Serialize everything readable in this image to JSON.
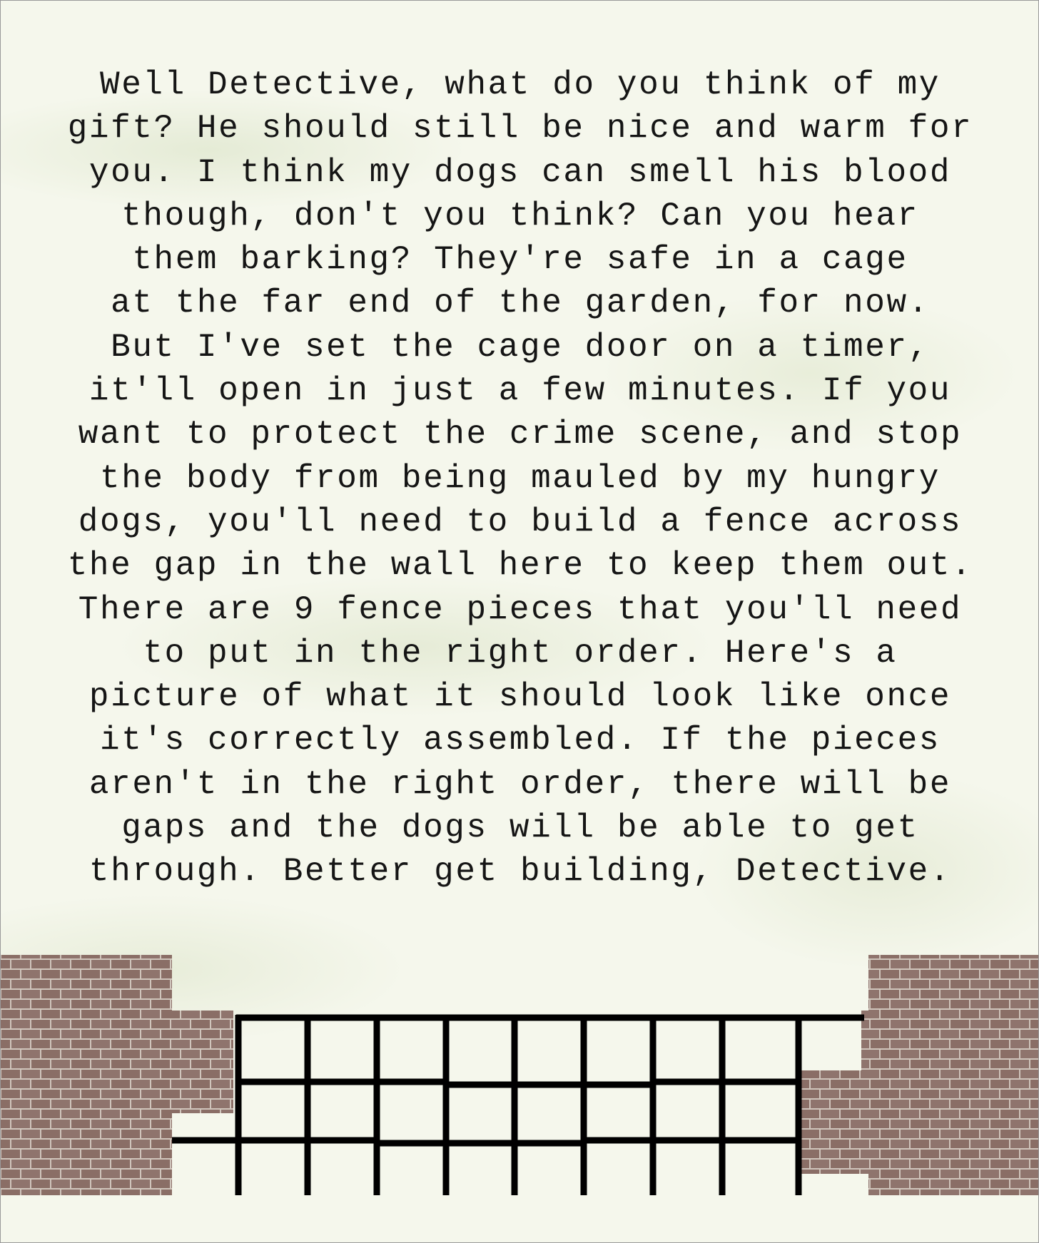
{
  "letter": {
    "lines": [
      "Well Detective, what do you think of my",
      "gift? He should still be nice and warm for",
      "you. I think my dogs can smell his blood",
      "though, don't you think? Can you hear",
      "them barking? They're safe in a cage",
      "at the far end of the garden, for now.",
      "But I've set the cage door on a timer,",
      "it'll open in just a few minutes. If you",
      "want to protect the crime scene, and stop",
      "the body from being mauled by my hungry",
      "dogs, you'll need to build a fence across",
      "the gap in the wall here to keep them out.",
      "There are 9 fence pieces that you'll need",
      "to put in the right order. Here's a",
      "picture of what it should look like once",
      "it's correctly assembled. If the pieces",
      "aren't in the right order, there will be",
      "gaps and the dogs will be able to get",
      "through. Better get building, Detective."
    ]
  },
  "scene": {
    "brick_color": "#8a6e66",
    "mortar_color": "#cfc4bb",
    "fence_color": "#000000",
    "fence_piece_count": 9
  }
}
